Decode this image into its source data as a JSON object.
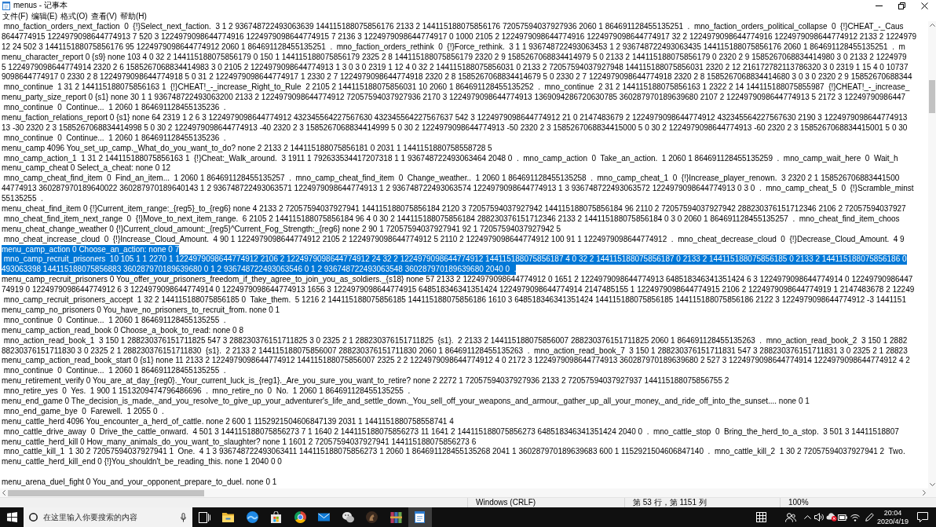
{
  "window": {
    "title": "menus - 记事本"
  },
  "menu_bar": [
    "文件(F)",
    "编辑(E)",
    "格式(O)",
    "查看(V)",
    "帮助(H)"
  ],
  "editor": {
    "lines": [
      {
        "kind": "text",
        "selected": false,
        "text": " mno_faction_orders_next_faction  0  {!}Select_next_faction.  3 1 2 936748722493063639 144115188075856176 2133 2 144115188075856176 72057594037927936 2060 1 864691128455135251  .  mno_faction_orders_political_collapse  0  {!}CHEAT_-_Caus"
      },
      {
        "kind": "text",
        "selected": false,
        "text": "8644774915 1224979098644774913 7 520 3 1224979098644774916 1224979098644774915 7 2136 3 1224979098644774917 0 1000 2105 2 1224979098644774916 1224979098644774917 32 2 1224979098644774916 1224979098644774912 2133 2 1224979"
      },
      {
        "kind": "text",
        "selected": false,
        "text": "12 24 502 3 144115188075856176 95 1224979098644774912 2060 1 864691128455135251  .  mno_faction_orders_rethink  0  {!}Force_rethink.  3 1 1 936748722493063453 1 2 936748722493063435 144115188075856176 2060 1 864691128455135251  .  m"
      },
      {
        "kind": "text",
        "selected": false,
        "text": "menu_character_report 0 {s9} none 103 4 0 32 2 144115188075856179 0 150 1 144115188075856179 2325 2 8 144115188075856179 2320 2 9 1585267068834414979 5 0 2133 2 144115188075856179 0 2320 2 9 1585267068834414980 3 0 2133 2 1224979"
      },
      {
        "kind": "text",
        "selected": false,
        "text": "5 1224979098644774914 2320 2 6 1585267068834414983 3 0 2105 2 1224979098644774913 1 3 0 3 0 2319 1 12 4 0 32 2 144115188075856031 0 2133 2 72057594037927948 144115188075856031 2320 2 12 216172782113786320 3 0 2319 1 15 4 0 10737"
      },
      {
        "kind": "text",
        "selected": false,
        "text": "9098644774917 0 2330 2 8 1224979098644774918 5 0 31 2 1224979098644774917 1 2330 2 7 1224979098644774918 2320 2 8 1585267068834414679 5 0 2330 2 7 1224979098644774918 2320 2 8 1585267068834414680 3 0 3 0 2320 2 9 15852670688344"
      },
      {
        "kind": "text",
        "selected": false,
        "text": " mno_continue  1 31 2 144115188075856163 1  {!}CHEAT!_-_increase_Right_to_Rule  2 2105 2 144115188075856031 10 2060 1 864691128455135252  .  mno_continue  2 31 2 144115188075856163 1 2322 2 14 144115188075855987  {!}CHEAT!_-_increase_"
      },
      {
        "kind": "text",
        "selected": false,
        "text": "menu_party_size_report 0 {s1} none 30 1 1 936748722493063200 2133 2 1224979098644774912 72057594037927936 2170 3 1224979098644774913 1369094286720630785 360287970189639680 2107 2 1224979098644774913 5 2172 3 12249790986447"
      },
      {
        "kind": "text",
        "selected": false,
        "text": " mno_continue  0  Continue...  1 2060 1 864691128455135236  ."
      },
      {
        "kind": "text",
        "selected": false,
        "text": "menu_faction_relations_report 0 {s1} none 64 2319 1 2 6 3 1224979098644774912 432345564227567630 432345564227567637 542 3 1224979098644774912 21 0 2147483679 2 1224979098644774912 432345564227567630 2190 3 1224979098644774913"
      },
      {
        "kind": "text",
        "selected": false,
        "text": "13 -30 2320 2 3 1585267068834414998 5 0 30 2 1224979098644774913 -40 2320 2 3 1585267068834414999 5 0 30 2 1224979098644774913 -50 2320 2 3 1585267068834415000 5 0 30 2 1224979098644774913 -60 2320 2 3 1585267068834415001 5 0 30"
      },
      {
        "kind": "text",
        "selected": false,
        "text": " mno_continue  0  Continue...  1 2060 1 864691128455135236  ."
      },
      {
        "kind": "text",
        "selected": false,
        "text": "menu_camp 4096 You_set_up_camp._What_do_you_want_to_do? none 2 2133 2 144115188075856181 0 2031 1 1441151880758558728 5"
      },
      {
        "kind": "text",
        "selected": false,
        "text": " mno_camp_action_1  1 31 2 144115188075856163 1  {!}Cheat:_Walk_around.  3 1911 1 792633534417207318 1 1 936748722493063464 2048 0  .  mno_camp_action  0  Take_an_action.  1 2060 1 864691128455135259  .  mno_camp_wait_here  0  Wait_h"
      },
      {
        "kind": "text",
        "selected": false,
        "text": "menu_camp_cheat 0 Select_a_cheat: none 0 12"
      },
      {
        "kind": "text",
        "selected": false,
        "text": " mno_camp_cheat_find_item  0  Find_an_item...  1 2060 1 864691128455135257  .  mno_camp_cheat_find_item  0  Change_weather..  1 2060 1 864691128455135258  .  mno_camp_cheat_1  0  {!}Increase_player_renown.  3 2320 2 1 158526706883441500"
      },
      {
        "kind": "text",
        "selected": false,
        "text": "44774913 360287970189640022 360287970189640143 1 2 936748722493063571 1224979098644774913 1 2 936748722493063574 1224979098644774913 1 3 936748722493063572 1224979098644774913 0 3 0  .  mno_camp_cheat_5  0  {!}Scramble_minst"
      },
      {
        "kind": "text",
        "selected": false,
        "text": "55135255  ."
      },
      {
        "kind": "text",
        "selected": false,
        "text": "menu_cheat_find_item 0 {!}Current_item_range:_{reg5}_to_{reg6} none 4 2133 2 72057594037927941 144115188075856184 2120 3 72057594037927942 144115188075856184 96 2110 2 72057594037927942 288230376151712346 2106 2 72057594037927"
      },
      {
        "kind": "text",
        "selected": false,
        "text": " mno_cheat_find_item_next_range  0  {!}Move_to_next_item_range.  6 2105 2 144115188075856184 96 4 0 30 2 144115188075856184 288230376151712346 2133 2 144115188075856184 0 3 0 2060 1 864691128455135257  .  mno_cheat_find_item_choos"
      },
      {
        "kind": "text",
        "selected": false,
        "text": "menu_cheat_change_weather 0 {!}Current_cloud_amount:_{reg5}^Current_Fog_Strength:_{reg6} none 2 90 1 72057594037927941 92 1 72057594037927942 5"
      },
      {
        "kind": "text",
        "selected": false,
        "text": " mno_cheat_increase_cloud  0  {!}Increase_Cloud_Amount.  4 90 1 1224979098644774912 2105 2 1224979098644774912 5 2110 2 1224979098644774912 100 91 1 1224979098644774912  .  mno_cheat_decrease_cloud  0  {!}Decrease_Cloud_Amount.  4 9"
      },
      {
        "kind": "text",
        "selected": true,
        "text": "menu_camp_action 0 Choose_an_action: none 0 7"
      },
      {
        "kind": "text",
        "selected": true,
        "text": " mno_camp_recruit_prisoners  10 105 1 1 2270 1 1224979098644774912 2106 2 1224979098644774912 24 32 2 1224979098644774912 144115188075856187 4 0 32 2 144115188075856187 0 2133 2 144115188075856185 0 2133 2 144115188075856186 0"
      },
      {
        "kind": "text",
        "selected": true,
        "text": "493063398 144115188075856883 360287970189639680 0 1 2 936748722493063546 0 1 2 936748722493063548 360287970189639680 2040 0  ."
      },
      {
        "kind": "text",
        "selected": false,
        "text": "menu_camp_recruit_prisoners 0 You_offer_your_prisoners_freedom_if_they_agree_to_join_you_as_soldiers._{s18} none 57 2133 2 1224979098644774912 0 1651 2 1224979098644774913 648518346341351424 6 3 1224979098644774914 0 12249790986447"
      },
      {
        "kind": "text",
        "selected": false,
        "text": "74919 0 1224979098644774912 6 3 1224979098644774914 0 1224979098644774913 1656 3 1224979098644774915 648518346341351424 1224979098644774914 2147485155 1 1224979098644774915 2106 2 1224979098644774919 1 2147483678 2 12249"
      },
      {
        "kind": "text",
        "selected": false,
        "text": " mno_camp_recruit_prisoners_accept  1 32 2 144115188075856185 0  Take_them.  5 1216 2 144115188075856185 144115188075856186 1610 3 648518346341351424 144115188075856185 144115188075856186 2122 3 1224979098644774912 -3 1441151"
      },
      {
        "kind": "text",
        "selected": false,
        "text": "menu_camp_no_prisoners 0 You_have_no_prisoners_to_recruit_from. none 0 1"
      },
      {
        "kind": "text",
        "selected": false,
        "text": " mno_continue  0  Continue...  1 2060 1 864691128455135255  ."
      },
      {
        "kind": "text",
        "selected": false,
        "text": "menu_camp_action_read_book 0 Choose_a_book_to_read: none 0 8"
      },
      {
        "kind": "text",
        "selected": false,
        "text": " mno_action_read_book_1  3 150 1 288230376151711825 547 3 288230376151711825 3 0 2325 2 1 288230376151711825  {s1}.  2 2133 2 144115188075856007 288230376151711825 2060 1 864691128455135263  .  mno_action_read_book_2  3 150 1 2882"
      },
      {
        "kind": "text",
        "selected": false,
        "text": "88230376151711830 3 0 2325 2 1 288230376151711830  {s1}.  2 2133 2 144115188075856007 288230376151711830 2060 1 864691128455135263  .  mno_action_read_book_7  3 150 1 288230376151711831 547 3 288230376151711831 3 0 2325 2 1 28823"
      },
      {
        "kind": "text",
        "selected": false,
        "text": "menu_camp_action_read_book_start 0 {s1} none 11 2133 2 1224979098644774912 144115188075856007 2325 2 2 1224979098644774912 4 0 2172 3 1224979098644774913 360287970189639680 2 527 3 1224979098644774914 1224979098644774912 4 2"
      },
      {
        "kind": "text",
        "selected": false,
        "text": " mno_continue  0  Continue...  1 2060 1 864691128455135255  ."
      },
      {
        "kind": "text",
        "selected": false,
        "text": "menu_retirement_verify 0 You_are_at_day_{reg0}._Your_current_luck_is_{reg1}._Are_you_sure_you_want_to_retire? none 2 2272 1 72057594037927936 2133 2 72057594037927937 144115188075856755 2"
      },
      {
        "kind": "text",
        "selected": false,
        "text": " mno_retire_yes  0  Yes.  1 900 1 1513209474796486696  .  mno_retire_no  0  No.  1 2060 1 864691128455135255  ."
      },
      {
        "kind": "text",
        "selected": false,
        "text": "menu_end_game 0 The_decision_is_made,_and_you_resolve_to_give_up_your_adventurer's_life_and_settle_down._You_sell_off_your_weapons_and_armour,_gather_up_all_your_money,_and_ride_off_into_the_sunset.... none 0 1"
      },
      {
        "kind": "text",
        "selected": false,
        "text": " mno_end_game_bye  0  Farewell.  1 2055 0  ."
      },
      {
        "kind": "text",
        "selected": false,
        "text": "menu_cattle_herd 4096 You_encounter_a_herd_of_cattle. none 2 600 1 1152921504606847139 2031 1 1441151880758558741 4"
      },
      {
        "kind": "text",
        "selected": false,
        "text": " mno_cattle_drive_away  0  Drive_the_cattle_onward.  4 501 3 144115188075856273 7 1 1640 2 144115188075856273 11 1641 2 144115188075856273 648518346341351424 2040 0  .  mno_cattle_stop  0  Bring_the_herd_to_a_stop.  3 501 3 14411518807"
      },
      {
        "kind": "text",
        "selected": false,
        "text": "menu_cattle_herd_kill 0 How_many_animals_do_you_want_to_slaughter? none 1 1601 2 72057594037927941 144115188075856273 6"
      },
      {
        "kind": "text",
        "selected": false,
        "text": " mno_cattle_kill_1  1 30 2 72057594037927941 1  One.  4 1 3 936748722493063411 144115188075856273 1 2060 1 864691128455135268 2041 1 360287970189639683 600 1 1152921504606847140  .  mno_cattle_kill_2  1 30 2 72057594037927941 2  Two."
      },
      {
        "kind": "text",
        "selected": false,
        "text": "menu_cattle_herd_kill_end 0 {!}You_shouldn't_be_reading_this. none 1 2040 0 0"
      },
      {
        "kind": "blank",
        "selected": false
      },
      {
        "kind": "text",
        "selected": false,
        "text": "menu_arena_duel_fight 0 You_and_your_opponent_prepare_to_duel. none 0 1"
      }
    ]
  },
  "status_bar": {
    "line_ending": "Windows (CRLF)",
    "position": "第 53 行，第 1151 列",
    "zoom": "100%"
  },
  "taskbar": {
    "search": {
      "placeholder": "在这里输入你要搜索的内容"
    },
    "apps": [
      {
        "kind": "task-view",
        "selected": false
      },
      {
        "kind": "folder",
        "selected": false
      },
      {
        "kind": "swirl",
        "selected": false
      },
      {
        "kind": "bag",
        "selected": false
      },
      {
        "kind": "wheel",
        "selected": false
      },
      {
        "kind": "mail",
        "selected": false
      },
      {
        "kind": "chat",
        "selected": false
      },
      {
        "kind": "emblem",
        "selected": false
      },
      {
        "kind": "books",
        "selected": false
      },
      {
        "kind": "notepad",
        "selected": true
      }
    ],
    "clock": {
      "time": "20:04",
      "date": "2020/4/19"
    }
  }
}
